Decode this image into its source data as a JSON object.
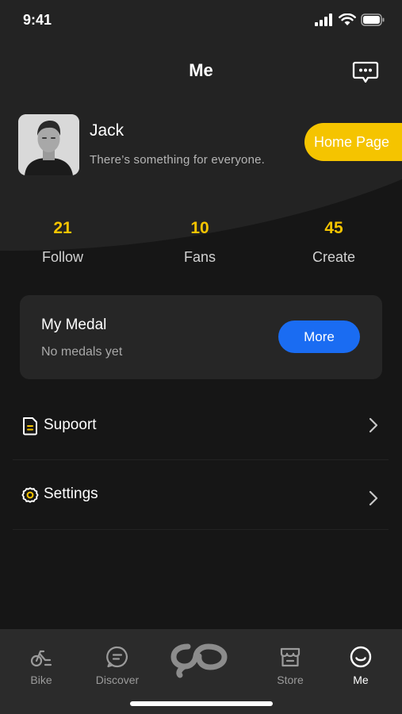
{
  "status_bar": {
    "time": "9:41"
  },
  "header": {
    "title": "Me"
  },
  "profile": {
    "name": "Jack",
    "bio": "There’s something for everyone.",
    "home_page_label": "Home Page"
  },
  "stats": [
    {
      "value": "21",
      "label": "Follow"
    },
    {
      "value": "10",
      "label": "Fans"
    },
    {
      "value": "45",
      "label": "Create"
    }
  ],
  "medal": {
    "title": "My Medal",
    "subtitle": "No medals yet",
    "more_label": "More"
  },
  "menu": [
    {
      "label": "Supoort",
      "icon": "document-icon"
    },
    {
      "label": "Settings",
      "icon": "gear-icon"
    }
  ],
  "tabs": [
    {
      "label": "Bike",
      "icon": "bike-icon",
      "active": false
    },
    {
      "label": "Discover",
      "icon": "chat-bubble-icon",
      "active": false
    },
    {
      "label": "",
      "icon": "go-logo-icon",
      "active": false
    },
    {
      "label": "Store",
      "icon": "store-icon",
      "active": false
    },
    {
      "label": "Me",
      "icon": "smile-icon",
      "active": true
    }
  ],
  "colors": {
    "background": "#161616",
    "header_background": "#232323",
    "accent_yellow": "#f5c400",
    "button_blue": "#1a6cf2",
    "card": "#262626",
    "tab_bar": "#2b2b2b"
  }
}
